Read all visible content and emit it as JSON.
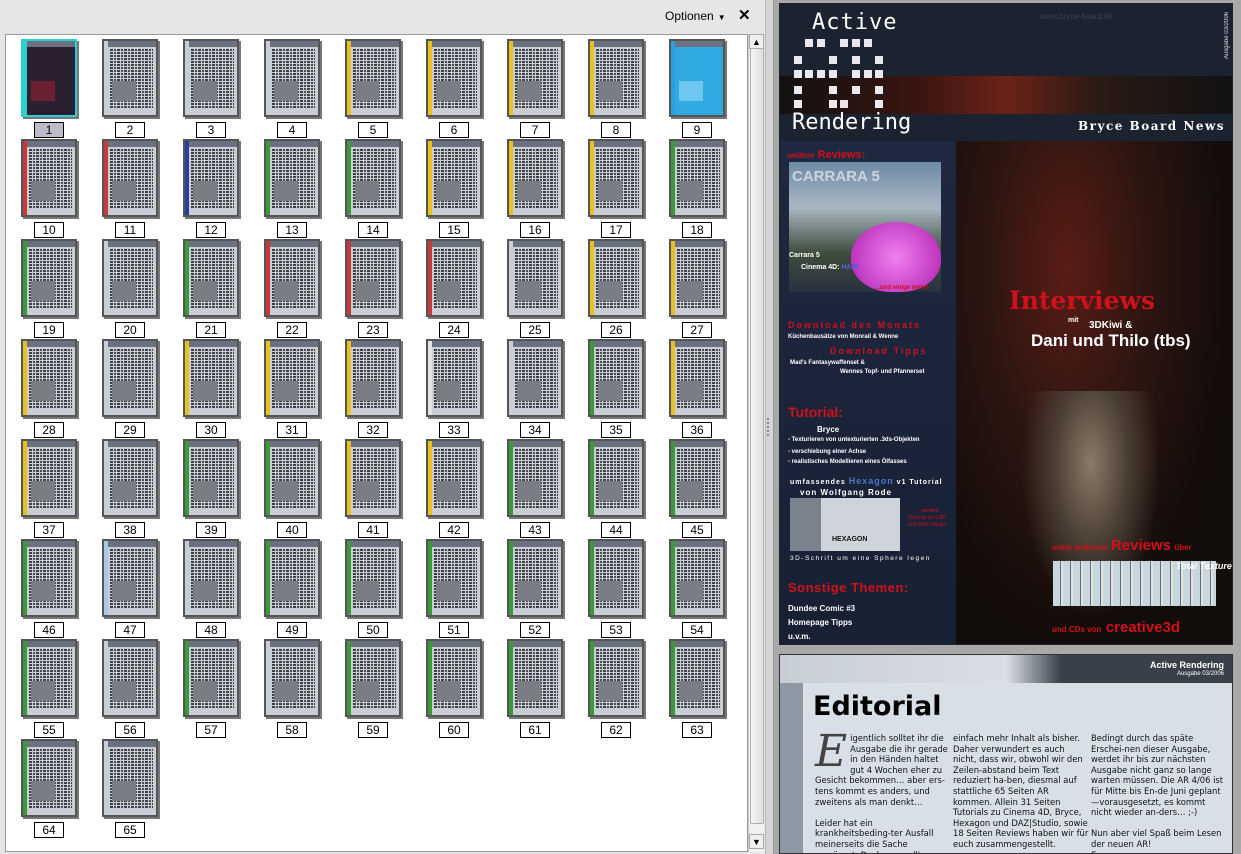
{
  "panel": {
    "options_label": "Optionen",
    "options_caret": "▼",
    "close_label": "✕"
  },
  "thumbnails": [
    {
      "label": "1",
      "accent": "#2bd0d0",
      "selected": true
    },
    {
      "label": "2",
      "accent": "#c9ced6"
    },
    {
      "label": "3",
      "accent": "#c9ced6"
    },
    {
      "label": "4",
      "accent": "#c9ced6"
    },
    {
      "label": "5",
      "accent": "#e8c020"
    },
    {
      "label": "6",
      "accent": "#e8c020"
    },
    {
      "label": "7",
      "accent": "#e8c020"
    },
    {
      "label": "8",
      "accent": "#e8c020"
    },
    {
      "label": "9",
      "accent": "#2a9ee0"
    },
    {
      "label": "10",
      "accent": "#c83a3a"
    },
    {
      "label": "11",
      "accent": "#c83a3a"
    },
    {
      "label": "12",
      "accent": "#2a3ea0"
    },
    {
      "label": "13",
      "accent": "#3a9a3a"
    },
    {
      "label": "14",
      "accent": "#3a9a3a"
    },
    {
      "label": "15",
      "accent": "#e8c020"
    },
    {
      "label": "16",
      "accent": "#e8c020"
    },
    {
      "label": "17",
      "accent": "#e8c020"
    },
    {
      "label": "18",
      "accent": "#3a9a3a"
    },
    {
      "label": "19",
      "accent": "#3a9a3a"
    },
    {
      "label": "20",
      "accent": "#c9ced6"
    },
    {
      "label": "21",
      "accent": "#3a9a3a"
    },
    {
      "label": "22",
      "accent": "#c83a3a"
    },
    {
      "label": "23",
      "accent": "#c83a3a"
    },
    {
      "label": "24",
      "accent": "#c83a3a"
    },
    {
      "label": "25",
      "accent": "#c9ced6"
    },
    {
      "label": "26",
      "accent": "#e8c020"
    },
    {
      "label": "27",
      "accent": "#e8c020"
    },
    {
      "label": "28",
      "accent": "#e8c020"
    },
    {
      "label": "29",
      "accent": "#c9ced6"
    },
    {
      "label": "30",
      "accent": "#e8c020"
    },
    {
      "label": "31",
      "accent": "#e8c020"
    },
    {
      "label": "32",
      "accent": "#e8c020"
    },
    {
      "label": "33",
      "accent": "#e4e4e4"
    },
    {
      "label": "34",
      "accent": "#c9ced6"
    },
    {
      "label": "35",
      "accent": "#3a9a3a"
    },
    {
      "label": "36",
      "accent": "#e8c020"
    },
    {
      "label": "37",
      "accent": "#e8c020"
    },
    {
      "label": "38",
      "accent": "#c9ced6"
    },
    {
      "label": "39",
      "accent": "#3a9a3a"
    },
    {
      "label": "40",
      "accent": "#3a9a3a"
    },
    {
      "label": "41",
      "accent": "#e8c020"
    },
    {
      "label": "42",
      "accent": "#e8c020"
    },
    {
      "label": "43",
      "accent": "#3a9a3a"
    },
    {
      "label": "44",
      "accent": "#3a9a3a"
    },
    {
      "label": "45",
      "accent": "#3a9a3a"
    },
    {
      "label": "46",
      "accent": "#3a9a3a"
    },
    {
      "label": "47",
      "accent": "#a8c8e8"
    },
    {
      "label": "48",
      "accent": "#c9ced6"
    },
    {
      "label": "49",
      "accent": "#3a9a3a"
    },
    {
      "label": "50",
      "accent": "#3a9a3a"
    },
    {
      "label": "51",
      "accent": "#3a9a3a"
    },
    {
      "label": "52",
      "accent": "#3a9a3a"
    },
    {
      "label": "53",
      "accent": "#3a9a3a"
    },
    {
      "label": "54",
      "accent": "#3a9a3a"
    },
    {
      "label": "55",
      "accent": "#3a9a3a"
    },
    {
      "label": "56",
      "accent": "#c9ced6"
    },
    {
      "label": "57",
      "accent": "#3a9a3a"
    },
    {
      "label": "58",
      "accent": "#c9ced6"
    },
    {
      "label": "59",
      "accent": "#3a9a3a"
    },
    {
      "label": "60",
      "accent": "#3a9a3a"
    },
    {
      "label": "61",
      "accent": "#3a9a3a"
    },
    {
      "label": "62",
      "accent": "#3a9a3a"
    },
    {
      "label": "63",
      "accent": "#3a9a3a"
    },
    {
      "label": "64",
      "accent": "#3a9a3a"
    },
    {
      "label": "65",
      "accent": "#c9ced6"
    }
  ],
  "cover": {
    "logo_top": "Active",
    "logo_bottom": "Rendering",
    "tagline": "Bryce Board News",
    "issue": "Ausgabe 03/2006",
    "url": "www.bryce-board.de",
    "reviews_prefix": "weitere",
    "reviews_title": "Reviews:",
    "carrara_logo": "CARRARA 5",
    "review_1": "Carrara 5",
    "review_2_prefix": "Cinema 4D:",
    "review_2_hl": "HAIR",
    "reviews_more": "...und einige mehr!",
    "download_month": "Download des Monats",
    "download_month_text": "Küchenbausätze von Monrail & Wenne",
    "download_tips": "Download Tipps",
    "tips_1": "Mad's Fantasywaffenset &",
    "tips_2": "Wennes Topf- und Pfannerset",
    "tutorial_title": "Tutorial:",
    "tutorial_sub": "Bryce",
    "tut_1": "- Texturieren von untexturierten .3ds-Objekten",
    "tut_2": "- verschiebung einer Achse",
    "tut_3": "- realistisches Modellieren eines Ölfasses",
    "hex_pre": "umfassendes",
    "hex_hl": "Hexagon",
    "hex_post": "v1  Tutorial",
    "hex_author": "von Wolfgang Rode",
    "hex_logo": "HEXAGON",
    "hex_more": "... weitere Tutorial zu C4D und DAZ-Studio",
    "sphere": "3D-Schrift um eine Sphere legen",
    "other_title": "Sonstige Themen:",
    "other_1": "Dundee Comic #3",
    "other_2": "Homepage Tipps",
    "other_3": "u.v.m.",
    "interviews": "Interviews",
    "int_mit": "mit",
    "int_1": "3DKiwi &",
    "int_2": "Dani und Thilo (tbs)",
    "rev_pre": "unter anderem",
    "rev_hl": "Reviews",
    "rev_post": "über",
    "tt_logo": "Total Textures",
    "cds_pre": "und  CDs von",
    "cds_hl": "creative3d"
  },
  "editorial": {
    "header_title": "Active Rendering",
    "header_issue": "Ausgabe 03/2006",
    "title": "Editorial",
    "dropcap": "E",
    "col1": "igentlich solltet ihr die Ausgabe die ihr gerade in  den Händen haltet gut 4 Wochen eher zu Gesicht bekommen… aber ers-tens kommt es anders, und zweitens als man denkt…\n\nLeider hat ein krankheitsbeding-ter Ausfall meinerseits die Sache verzögert. Doch was soll's, nun ist es soweit.",
    "col2": "einfach mehr Inhalt als bisher. Daher verwundert es auch nicht, dass wir, obwohl wir den Zeilen-abstand beim Text reduziert ha-ben, diesmal auf stattliche 65 Seiten AR kommen. Allein 31 Seiten Tutorials zu Cinema 4D, Bryce, Hexagon und DAZ|Studio, sowie 18 Seiten Reviews haben wir für euch zusammengestellt.\n\nHinzu kommen zwei, wie ich fin-de, hochinteressante Interviews",
    "col3": "Bedingt durch das späte Erschei-nen dieser Ausgabe, werdet ihr bis zur nächsten Ausgabe nicht ganz so lange warten müssen. Die AR 4/06 ist für Mitte bis En-de Juni geplant—vorausgesetzt, es kommt nicht wieder an-ders… ;-)\n\nNun aber viel Spaß beim Lesen der neuen AR!\nEuer"
  }
}
